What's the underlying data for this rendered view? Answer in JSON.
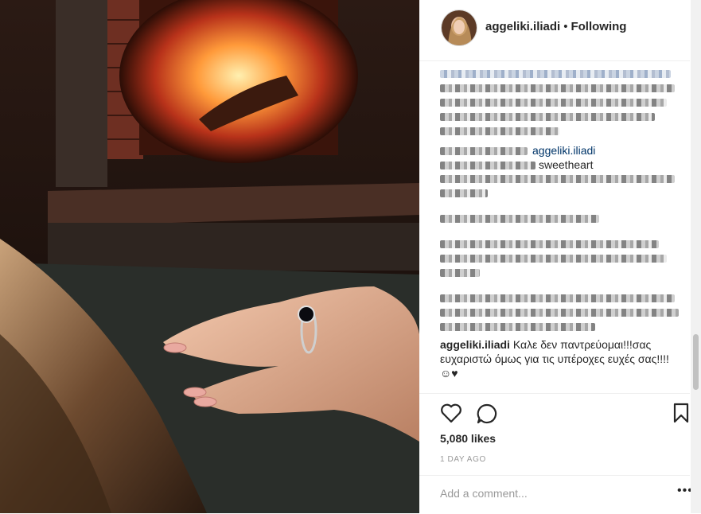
{
  "post": {
    "username": "aggeliki.iliadi",
    "separator": "•",
    "follow_status": "Following",
    "reply": {
      "username": "aggeliki.iliadi",
      "text": "Καλε δεν παντρεύομαι!!!σας ευχαριστώ όμως για τις υπέροχες ευχές σας!!!!☺♥"
    },
    "comment_fragments": {
      "mention": "aggeliki.iliadi",
      "word": "sweetheart"
    },
    "likes": "5,080 likes",
    "time": "1 DAY AGO",
    "comment_placeholder": "Add a comment...",
    "more_label": "•••"
  },
  "icons": [
    "heart-icon",
    "comment-icon",
    "bookmark-icon",
    "more-options-icon"
  ],
  "colors": {
    "link": "#003569",
    "muted": "#999999",
    "text": "#262626"
  }
}
